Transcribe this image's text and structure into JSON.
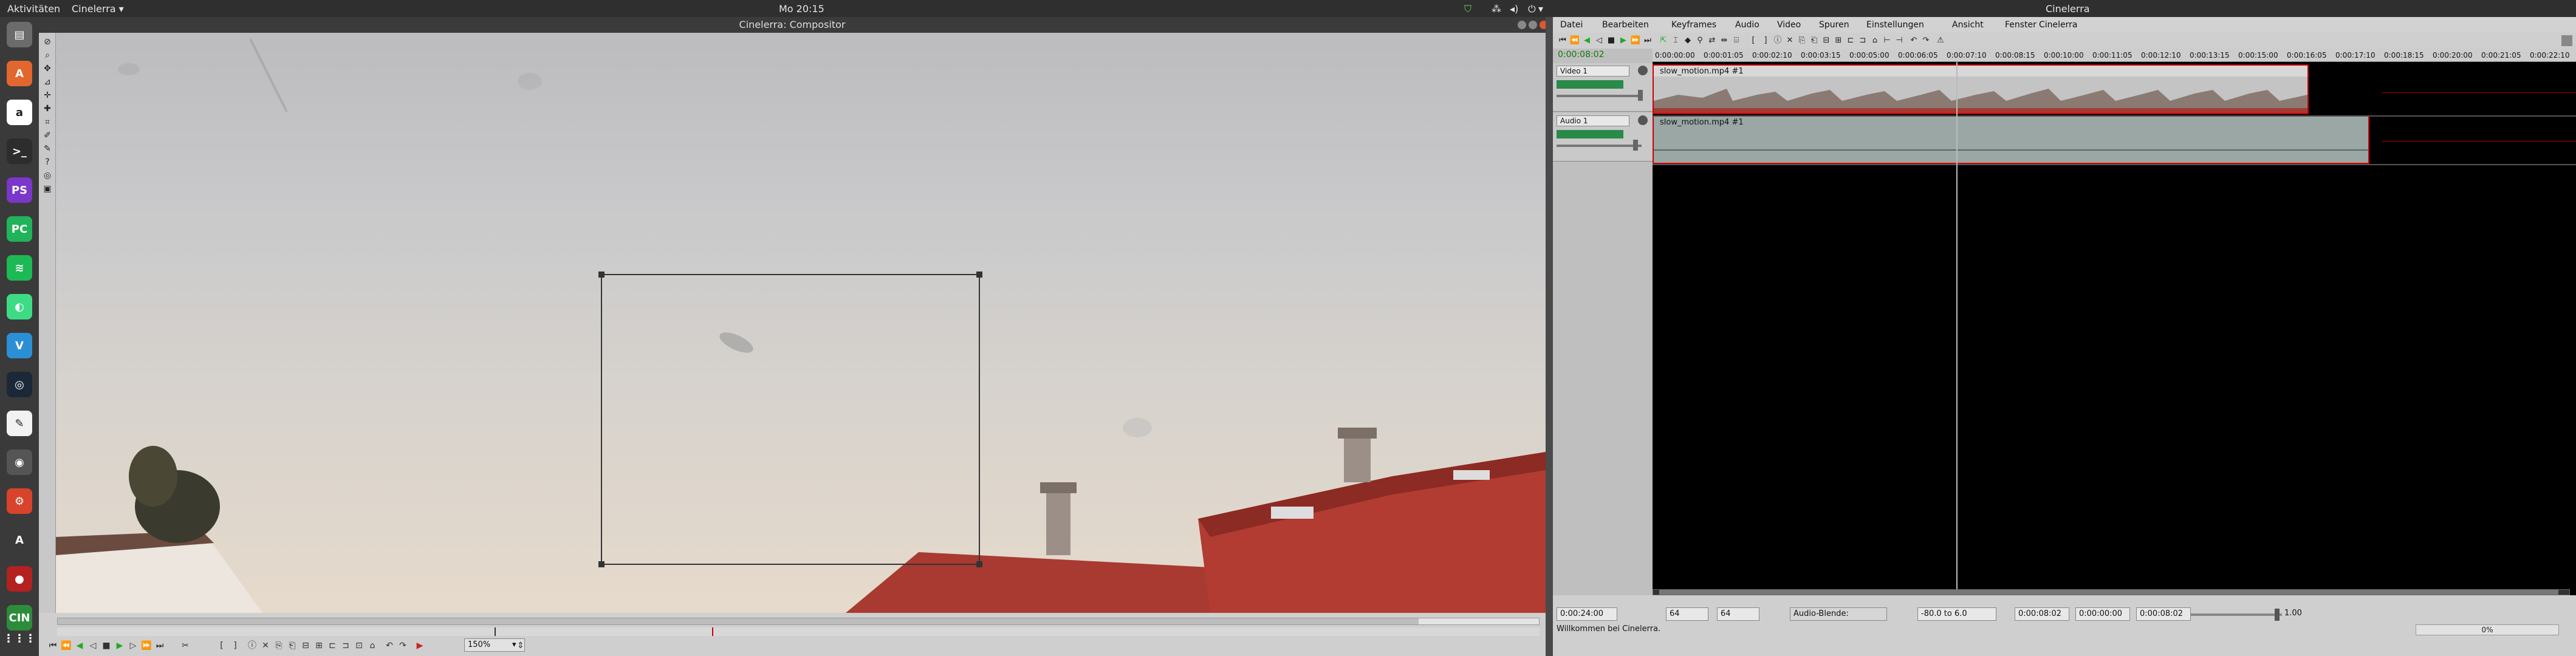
{
  "topbar": {
    "activities": "Aktivitäten",
    "app_menu": "Cinelerra ▾",
    "clock": "Mo 20:15",
    "tray_menu": "▾"
  },
  "dock": {
    "items": [
      {
        "name": "files-icon",
        "glyph": "▤",
        "color": "#6b6b6b"
      },
      {
        "name": "software-center-icon",
        "glyph": "A",
        "color": "#e2672f"
      },
      {
        "name": "amazon-icon",
        "glyph": "a",
        "color": "#ffffff"
      },
      {
        "name": "terminal-icon",
        "glyph": ">_",
        "color": "#2d2d2d"
      },
      {
        "name": "phpstorm-icon",
        "glyph": "PS",
        "color": "#7a37c9"
      },
      {
        "name": "pycharm-icon",
        "glyph": "PC",
        "color": "#21b35a"
      },
      {
        "name": "spotify-icon",
        "glyph": "≋",
        "color": "#1db954"
      },
      {
        "name": "android-studio-icon",
        "glyph": "◐",
        "color": "#3ddc84"
      },
      {
        "name": "vscode-icon",
        "glyph": "V",
        "color": "#2b8fd6"
      },
      {
        "name": "steam-icon",
        "glyph": "◎",
        "color": "#1b2838"
      },
      {
        "name": "notes-icon",
        "glyph": "✎",
        "color": "#f2f2f2"
      },
      {
        "name": "camera-icon",
        "glyph": "◉",
        "color": "#555555"
      },
      {
        "name": "settings-icon",
        "glyph": "⚙",
        "color": "#d9432b"
      },
      {
        "name": "updater-icon",
        "glyph": "A",
        "color": "#3a3a3a"
      },
      {
        "name": "recorder-icon",
        "glyph": "●",
        "color": "#b32121"
      },
      {
        "name": "cinelerra-icon",
        "glyph": "CIN",
        "color": "#2c8c3a"
      }
    ],
    "apps_grid": "⋮⋮⋮"
  },
  "compositor": {
    "title": "Cinelerra: Compositor",
    "zoom": "150%",
    "zoom_arrow": "▾"
  },
  "cinelerra": {
    "title": "Cinelerra",
    "menu": [
      "Datei",
      "Bearbeiten",
      "Keyframes",
      "Audio",
      "Video",
      "Spuren",
      "Einstellungen",
      "Ansicht",
      "Fenster"
    ],
    "time": "0:00:08:02",
    "ruler": [
      "0:00:00:00",
      "0:00:01:05",
      "0:00:02:10",
      "0:00:03:15",
      "0:00:05:00",
      "0:00:06:05",
      "0:00:07:10",
      "0:00:08:15",
      "0:00:10:00",
      "0:00:11:05",
      "0:00:12:10",
      "0:00:13:15",
      "0:00:15:00",
      "0:00:16:05",
      "0:00:17:10",
      "0:00:18:15",
      "0:00:20:00",
      "0:00:21:05",
      "0:00:22:10"
    ],
    "tracks": [
      {
        "label": "Video 1",
        "clip": "slow_motion.mp4 #1"
      },
      {
        "label": "Audio 1",
        "clip": "slow_motion.mp4 #1"
      }
    ],
    "status": {
      "duration": "0:00:24:00",
      "sample_zoom": "64",
      "amp_zoom": "64",
      "blend": "Audio-Blende:",
      "range": "-80.0 to 6.0",
      "pos1": "0:00:08:02",
      "pos2": "0:00:00:00",
      "pos3": "0:00:08:02",
      "speed": "1.00",
      "message": "Willkommen bei Cinelerra.",
      "progress": "0%"
    }
  }
}
